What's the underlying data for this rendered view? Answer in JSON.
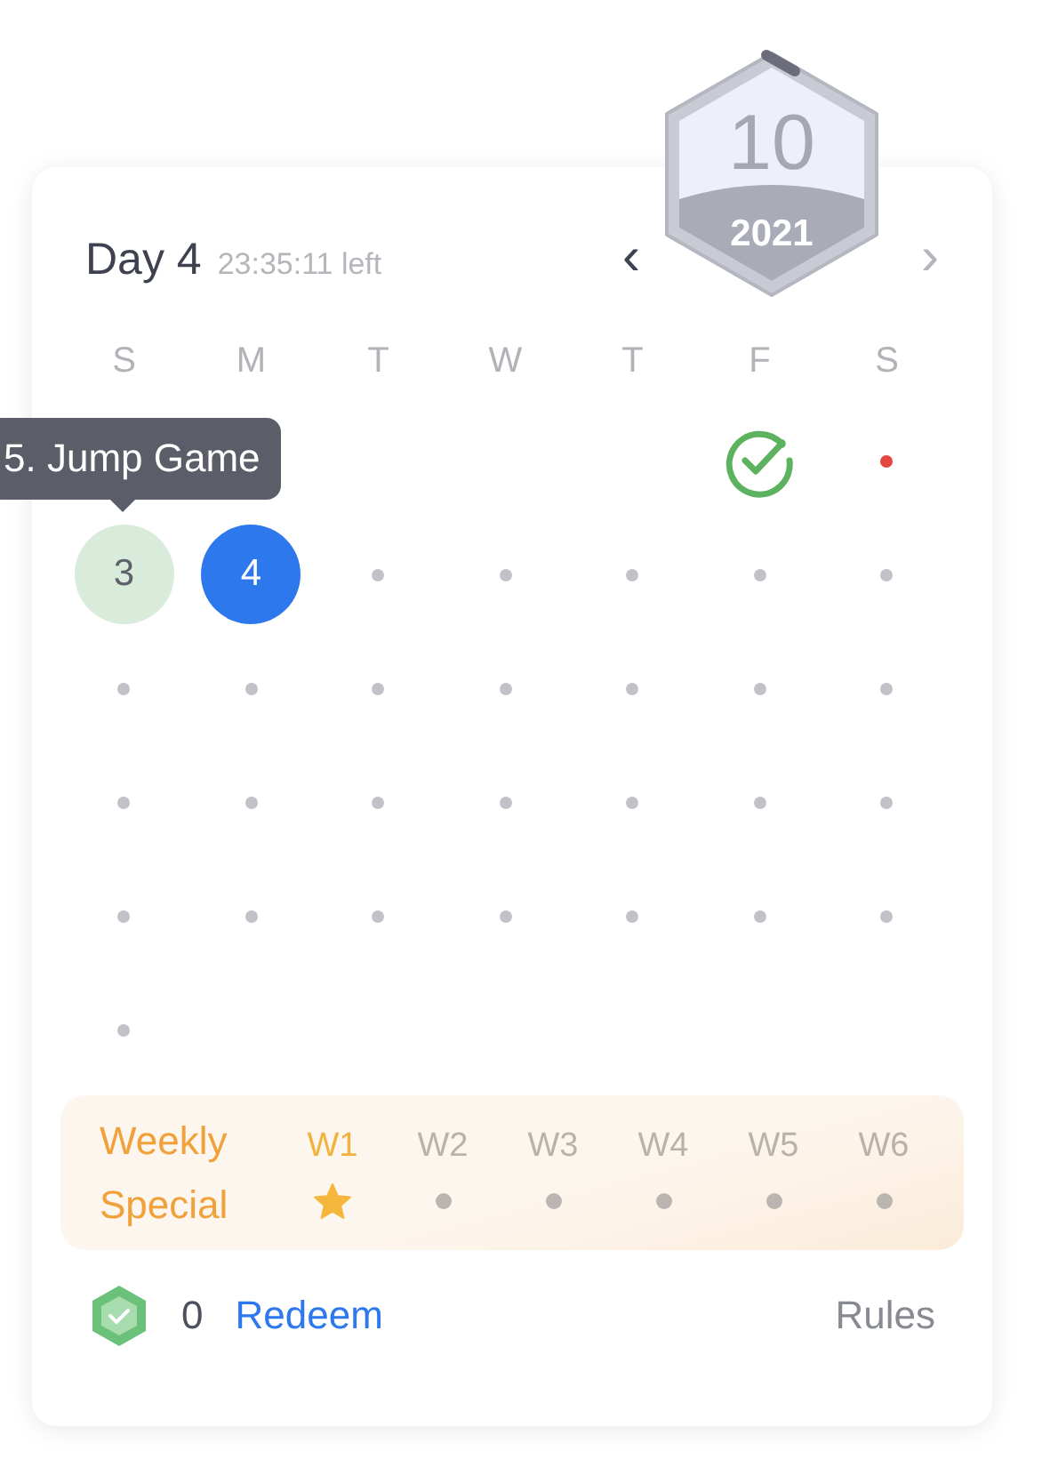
{
  "header": {
    "title": "Day 4",
    "countdown": "23:35:11 left",
    "prev": "‹",
    "next": "›"
  },
  "badge": {
    "number": "10",
    "year": "2021"
  },
  "weekdays": [
    "S",
    "M",
    "T",
    "W",
    "T",
    "F",
    "S"
  ],
  "tooltip": "5. Jump Game",
  "days": [
    {
      "kind": "empty"
    },
    {
      "kind": "empty"
    },
    {
      "kind": "empty"
    },
    {
      "kind": "empty"
    },
    {
      "kind": "empty"
    },
    {
      "kind": "checked"
    },
    {
      "kind": "missed"
    },
    {
      "kind": "solved",
      "label": "3"
    },
    {
      "kind": "today",
      "label": "4"
    },
    {
      "kind": "future"
    },
    {
      "kind": "future"
    },
    {
      "kind": "future"
    },
    {
      "kind": "future"
    },
    {
      "kind": "future"
    },
    {
      "kind": "future"
    },
    {
      "kind": "future"
    },
    {
      "kind": "future"
    },
    {
      "kind": "future"
    },
    {
      "kind": "future"
    },
    {
      "kind": "future"
    },
    {
      "kind": "future"
    },
    {
      "kind": "future"
    },
    {
      "kind": "future"
    },
    {
      "kind": "future"
    },
    {
      "kind": "future"
    },
    {
      "kind": "future"
    },
    {
      "kind": "future"
    },
    {
      "kind": "future"
    },
    {
      "kind": "future"
    },
    {
      "kind": "future"
    },
    {
      "kind": "future"
    },
    {
      "kind": "future"
    },
    {
      "kind": "future"
    },
    {
      "kind": "future"
    },
    {
      "kind": "future"
    },
    {
      "kind": "future"
    }
  ],
  "weekly": {
    "title": "Weekly Special",
    "weeks": [
      {
        "label": "W1",
        "selected": true,
        "done": true
      },
      {
        "label": "W2",
        "selected": false,
        "done": false
      },
      {
        "label": "W3",
        "selected": false,
        "done": false
      },
      {
        "label": "W4",
        "selected": false,
        "done": false
      },
      {
        "label": "W5",
        "selected": false,
        "done": false
      },
      {
        "label": "W6",
        "selected": false,
        "done": false
      }
    ]
  },
  "footer": {
    "coins": "0",
    "redeem": "Redeem",
    "rules": "Rules"
  }
}
